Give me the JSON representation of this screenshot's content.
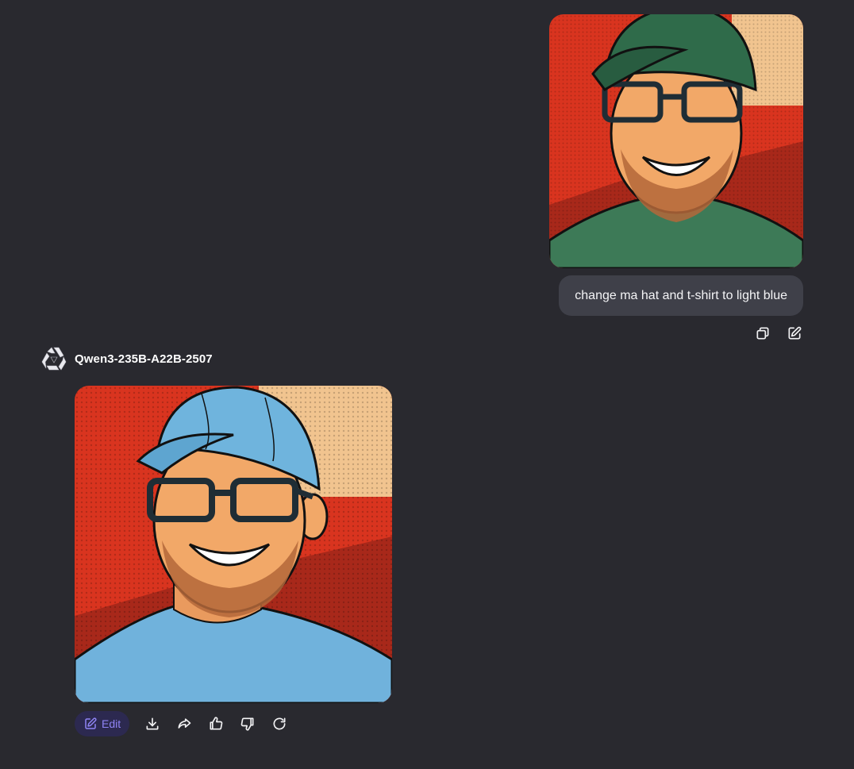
{
  "user_message": {
    "image": {
      "icon": "portrait-photo",
      "hat_color": "#2f6b4a",
      "shirt_color": "#3d7a57"
    },
    "text": "change ma hat and t-shirt to light blue",
    "actions": {
      "copy": "copy-icon",
      "edit": "edit-icon"
    }
  },
  "assistant": {
    "name": "Qwen3-235B-A22B-2507",
    "logo": "qwen-logo",
    "image": {
      "icon": "portrait-photo",
      "hat_color": "#6fb4dd",
      "shirt_color": "#70b2dc"
    },
    "actions": {
      "edit_label": "Edit",
      "download": "download-icon",
      "share": "share-icon",
      "like": "thumbs-up-icon",
      "dislike": "thumbs-down-icon",
      "regenerate": "regenerate-icon"
    }
  },
  "colors": {
    "background": "#29292f",
    "bubble": "#3f4049",
    "accent": "#8f84f5",
    "accent_bg": "#2c2950"
  }
}
